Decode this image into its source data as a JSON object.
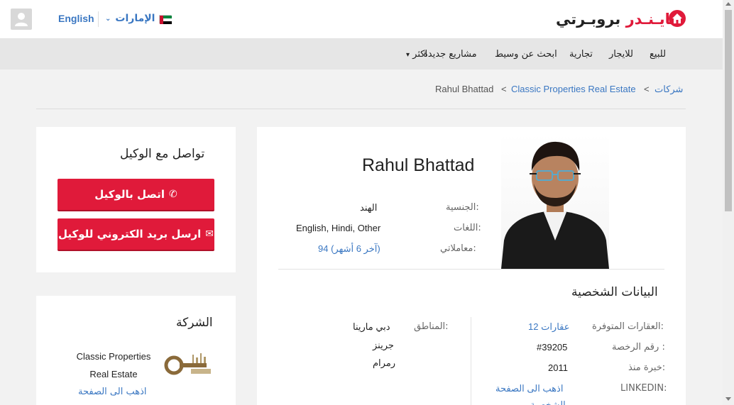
{
  "header": {
    "language_link": "English",
    "country_selector": "الإمارات",
    "logo_text_part1": "بروبـرتي",
    "logo_text_part2": "فايـنـدر"
  },
  "nav": {
    "items": [
      "للبيع",
      "للايجار",
      "تجارية",
      "ابحث عن وسيط",
      "مشاريع جديدة",
      "اكثر"
    ]
  },
  "breadcrumb": {
    "companies": "شركات",
    "company": "Classic Properties Real Estate",
    "current": "Rahul Bhattad",
    "separator": "<"
  },
  "contact": {
    "title": "تواصل مع الوكيل",
    "call_button": "اتصل بالوكيل",
    "email_button": "ارسل بريد الكتروني للوكيل"
  },
  "company": {
    "title": "الشركة",
    "name_line1": "Classic Properties",
    "name_line2": "Real Estate",
    "page_link": "اذهب الى الصفحة"
  },
  "profile": {
    "name": "Rahul Bhattad",
    "nationality_label": "الجنسية:",
    "nationality_value": "الهند",
    "languages_label": "اللغات:",
    "languages_value": "English, Hindi, Other",
    "transactions_label": "معاملاتي:",
    "transactions_value": "94 (آخر 6 أشهر)",
    "personal_title": "البيانات الشخصية",
    "properties_label": "العقارات المتوفرة:",
    "properties_value": "12 عقارات",
    "license_label": "رقم الرخصة :",
    "license_value": "#39205",
    "experience_label": "خبرة منذ:",
    "experience_value": "2011",
    "linkedin_label": "LINKEDIN:",
    "linkedin_value": "اذهب الى الصفحة",
    "linkedin_value_cont": "الشخصية",
    "areas_label": "المناطق:",
    "areas": [
      "دبي مارينا",
      "جرينز",
      "رمرام"
    ]
  },
  "colors": {
    "brand_red": "#e01a3a",
    "link_blue": "#3a77c2"
  }
}
